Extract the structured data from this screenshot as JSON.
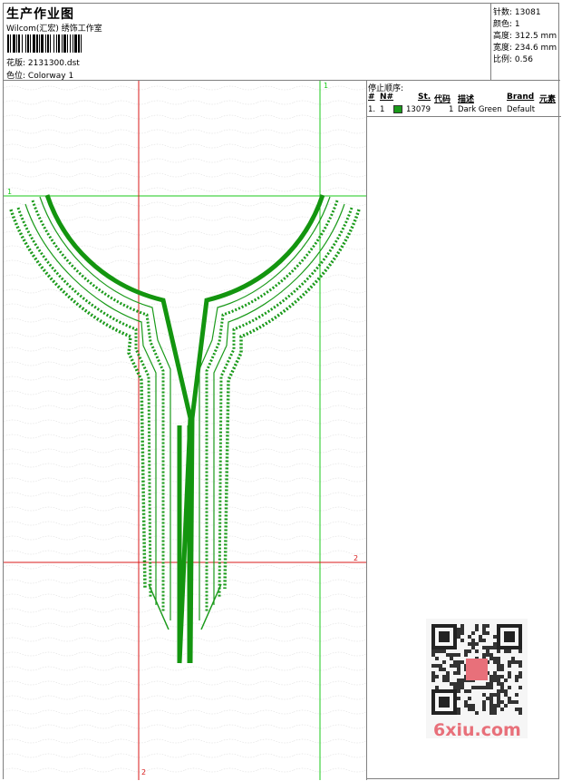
{
  "header": {
    "title": "生产作业图",
    "company": "Wilcom(汇宏) 绣饰工作室",
    "design_label": "花版:",
    "design_value": "2131300.dst",
    "colorway_label": "色位:",
    "colorway_value": "Colorway 1"
  },
  "stats": {
    "stitches_label": "针数:",
    "stitches_value": "13081",
    "colors_label": "颜色:",
    "colors_value": "1",
    "height_label": "高度:",
    "height_value": "312.5 mm",
    "width_label": "宽度:",
    "width_value": "234.6 mm",
    "scale_label": "比例:",
    "scale_value": "0.56"
  },
  "stop_sequence": {
    "title": "停止顺序:",
    "columns": [
      "#",
      "N#",
      "St.",
      "代码",
      "描述",
      "Brand",
      "元素"
    ],
    "rows": [
      {
        "num": "1.",
        "needle": "1",
        "color": "#1a9a1a",
        "stitches": "13079",
        "code": "1",
        "description": "Dark Green",
        "brand": "Default"
      }
    ]
  },
  "guides": {
    "label_1": "1",
    "label_2": "2"
  },
  "colors": {
    "thread": "#1a9a1a",
    "guide_green": "#19c819",
    "guide_red": "#d81818",
    "border": "#808080"
  },
  "watermark": {
    "text": "6xiu.com"
  }
}
